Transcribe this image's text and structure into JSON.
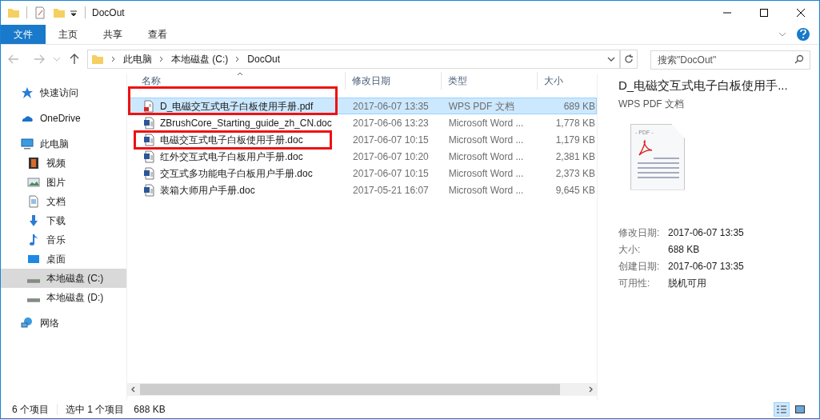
{
  "window": {
    "title": "DocOut"
  },
  "ribbon_tabs": [
    {
      "label": "文件",
      "selected": true
    },
    {
      "label": "主页",
      "selected": false
    },
    {
      "label": "共享",
      "selected": false
    },
    {
      "label": "查看",
      "selected": false
    }
  ],
  "address": {
    "path": [
      "此电脑",
      "本地磁盘 (C:)",
      "DocOut"
    ]
  },
  "search": {
    "placeholder": "搜索\"DocOut\""
  },
  "sidebar": {
    "items": [
      {
        "label": "快速访问",
        "kind": "star",
        "selected": false
      },
      {
        "label": "OneDrive",
        "kind": "cloud",
        "selected": false
      },
      {
        "label": "此电脑",
        "kind": "pc",
        "selected": false,
        "children": [
          {
            "label": "视频",
            "kind": "video",
            "selected": false
          },
          {
            "label": "图片",
            "kind": "image",
            "selected": false
          },
          {
            "label": "文档",
            "kind": "doc",
            "selected": false
          },
          {
            "label": "下载",
            "kind": "download",
            "selected": false
          },
          {
            "label": "音乐",
            "kind": "music",
            "selected": false
          },
          {
            "label": "桌面",
            "kind": "desktop",
            "selected": false
          },
          {
            "label": "本地磁盘 (C:)",
            "kind": "drive",
            "selected": true
          },
          {
            "label": "本地磁盘 (D:)",
            "kind": "drive",
            "selected": false
          }
        ]
      },
      {
        "label": "网络",
        "kind": "network",
        "selected": false
      }
    ]
  },
  "table": {
    "columns": [
      "名称",
      "修改日期",
      "类型",
      "大小"
    ],
    "rows": [
      {
        "kind": "pdf",
        "name": "D_电磁交互式电子白板使用手册.pdf",
        "date": "2017-06-07 13:35",
        "type": "WPS PDF 文档",
        "size": "689 KB",
        "selected": true,
        "highlighted": true
      },
      {
        "kind": "word",
        "name": "ZBrushCore_Starting_guide_zh_CN.doc",
        "date": "2017-06-06 13:23",
        "type": "Microsoft Word ...",
        "size": "1,778 KB",
        "selected": false,
        "highlighted": false
      },
      {
        "kind": "word",
        "name": "电磁交互式电子白板使用手册.doc",
        "date": "2017-06-07 10:15",
        "type": "Microsoft Word ...",
        "size": "1,179 KB",
        "selected": false,
        "highlighted": true
      },
      {
        "kind": "word",
        "name": "红外交互式电子白板用户手册.doc",
        "date": "2017-06-07 10:20",
        "type": "Microsoft Word ...",
        "size": "2,381 KB",
        "selected": false,
        "highlighted": false
      },
      {
        "kind": "word",
        "name": "交互式多功能电子白板用户手册.doc",
        "date": "2017-06-07 10:15",
        "type": "Microsoft Word ...",
        "size": "2,373 KB",
        "selected": false,
        "highlighted": false
      },
      {
        "kind": "word",
        "name": "装箱大师用户手册.doc",
        "date": "2017-05-21 16:07",
        "type": "Microsoft Word ...",
        "size": "9,645 KB",
        "selected": false,
        "highlighted": false
      }
    ]
  },
  "preview": {
    "title": "D_电磁交互式电子白板使用手...",
    "subtitle": "WPS PDF 文档",
    "thumb_label": "- PDF -",
    "properties": [
      {
        "label": "修改日期:",
        "value": "2017-06-07 13:35"
      },
      {
        "label": "大小:",
        "value": "688 KB"
      },
      {
        "label": "创建日期:",
        "value": "2017-06-07 13:35"
      },
      {
        "label": "可用性:",
        "value": "脱机可用"
      }
    ]
  },
  "status_bar": {
    "count": "6 个项目",
    "selection": "选中 1 个项目",
    "size": "688 KB"
  }
}
